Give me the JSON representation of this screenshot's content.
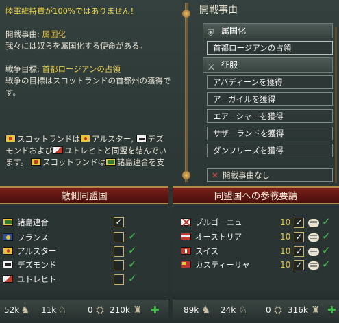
{
  "warning": "陸軍維持費が100%ではありません！",
  "cb_desc": {
    "label": "開戦事由:",
    "value": "属国化",
    "line2": "我々には奴らを属国化する使命がある。"
  },
  "war_goal": {
    "label": "戦争目標:",
    "value": "首都ロージアンの占領",
    "line2": "戦争の目標はスコットランドの首都州の獲得で",
    "line3": "す。"
  },
  "alliance_text": {
    "l1a": "スコットランドは",
    "l1b": "アルスター,",
    "l1c": "デズ",
    "l2": "モンドおよび",
    "l2b": "ユトレヒトと同盟を結んでい",
    "l3a": "ます。",
    "l3b": "スコットランドは",
    "l3c": "諸島連合を支"
  },
  "cb_panel": {
    "title": "開戦事由",
    "cat1": "属国化",
    "cat1_item": "首都ロージアンの占領",
    "cat2": "征服",
    "items": [
      "アバディーンを獲得",
      "アーガイルを獲得",
      "エアーシャーを獲得",
      "サザーランドを獲得",
      "ダンフリーズを獲得"
    ],
    "none": "開戦事由なし"
  },
  "enemy_allies": {
    "title": "敵側同盟国",
    "rows": [
      {
        "name": "諸島連合",
        "flag": "isles",
        "checked": true
      },
      {
        "name": "フランス",
        "flag": "france",
        "checked": false
      },
      {
        "name": "アルスター",
        "flag": "ulster",
        "checked": false
      },
      {
        "name": "デズモンド",
        "flag": "desmond",
        "checked": false
      },
      {
        "name": "ユトレヒト",
        "flag": "utrecht",
        "checked": false
      }
    ]
  },
  "call_allies": {
    "title": "同盟国への参戦要請",
    "rows": [
      {
        "name": "ブルゴーニュ",
        "flag": "burgundy",
        "value": "10"
      },
      {
        "name": "オーストリア",
        "flag": "austria",
        "value": "10"
      },
      {
        "name": "スイス",
        "flag": "swiss",
        "value": "10"
      },
      {
        "name": "カスティーリャ",
        "flag": "castile",
        "value": "10"
      }
    ]
  },
  "stats_left": {
    "infantry": "52k",
    "cavalry": "11k",
    "artillery": "0",
    "ships": "210k"
  },
  "stats_right": {
    "infantry": "89k",
    "cavalry": "24k",
    "artillery": "0",
    "ships": "316k"
  },
  "colors": {
    "accent_yellow": "#e8c84a",
    "check_green": "#3fbf4a",
    "banner_red": "#7a1f18"
  }
}
